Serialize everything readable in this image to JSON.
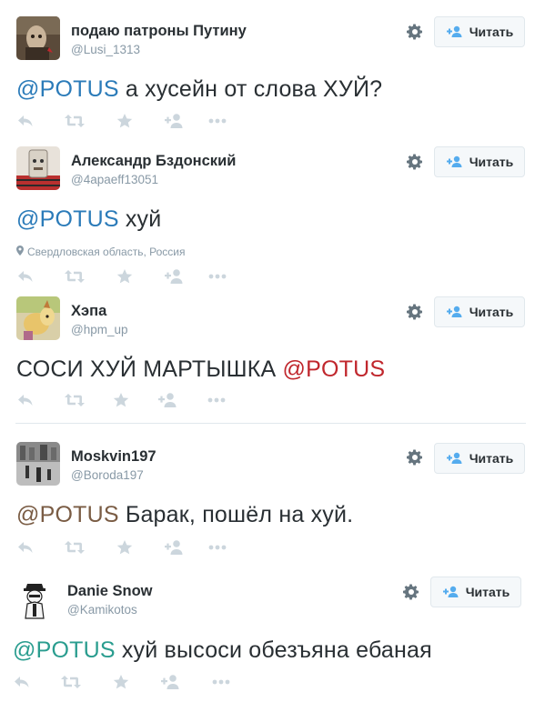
{
  "follow_label": "Читать",
  "colors": {
    "mention_blue": "#2b7bb9",
    "mention_red": "#c0272d",
    "mention_brown": "#7a5c44",
    "mention_teal": "#2a9d8f",
    "action_icon": "#ccd6dd"
  },
  "tweets": [
    {
      "name": "подаю патроны Путину",
      "handle": "@Lusi_1313",
      "mention": "@POTUS",
      "text": " а хусейн от слова ХУЙ?",
      "location": ""
    },
    {
      "name": "Александр Бздонский",
      "handle": "@4apaeff13051",
      "mention": "@POTUS",
      "text": " хуй",
      "location": "Свердловская область, Россия"
    },
    {
      "name": "Хэпа",
      "handle": "@hpm_up",
      "mention": "@POTUS",
      "text_before": "СОСИ ХУЙ МАРТЫШКА ",
      "location": ""
    },
    {
      "name": "Moskvin197",
      "handle": "@Boroda197",
      "mention": "@POTUS",
      "text": " Барак, пошёл на хуй.",
      "location": ""
    },
    {
      "name": "Danie Snow",
      "handle": "@Kamikotos",
      "mention": "@POTUS",
      "text": " хуй высоси обезъяна ебаная",
      "location": ""
    }
  ],
  "icons": [
    "reply-icon",
    "retweet-icon",
    "favorite-icon",
    "follow-small-icon",
    "more-icon",
    "gear-icon",
    "add-user-icon",
    "location-pin-icon"
  ]
}
